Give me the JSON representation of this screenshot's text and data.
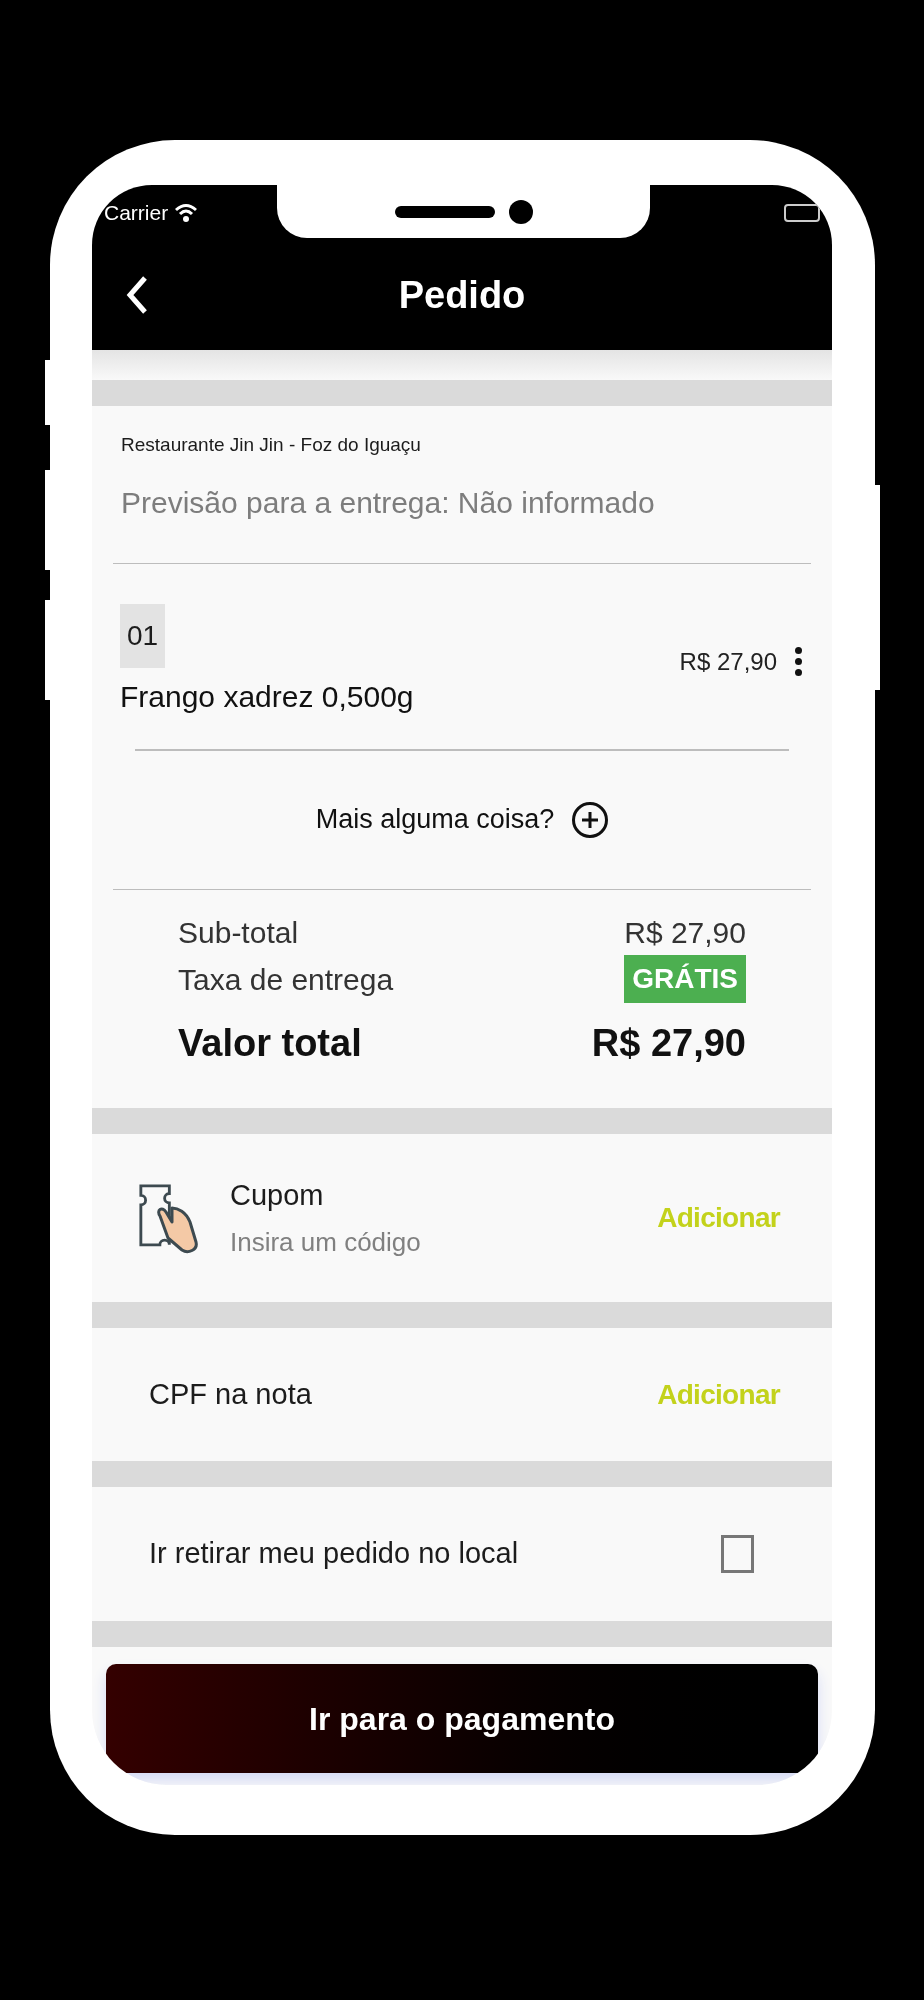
{
  "status_bar": {
    "carrier": "Carrier"
  },
  "header": {
    "title": "Pedido"
  },
  "order": {
    "restaurant": "Restaurante Jin Jin - Foz do Iguaçu",
    "delivery_estimate": "Previsão para a entrega: Não informado",
    "items": [
      {
        "quantity": "01",
        "name": "Frango xadrez 0,500g",
        "price": "R$ 27,90"
      }
    ],
    "add_more": "Mais alguma coisa?"
  },
  "summary": {
    "subtotal_label": "Sub-total",
    "subtotal": "R$ 27,90",
    "delivery_fee_label": "Taxa de entrega",
    "delivery_fee": "GRÁTIS",
    "total_label": "Valor total",
    "total": "R$ 27,90"
  },
  "options": [
    {
      "kind": "coupon",
      "title": "Cupom",
      "subtitle": "Insira um código",
      "action": "Adicionar"
    },
    {
      "kind": "action",
      "title": "CPF na nota",
      "action": "Adicionar"
    },
    {
      "kind": "checkbox",
      "title": "Ir retirar meu pedido no local",
      "checked": false
    }
  ],
  "checkout_button": "Ir para o pagamento"
}
